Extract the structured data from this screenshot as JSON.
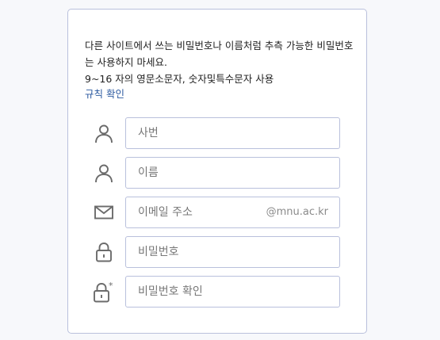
{
  "notice": {
    "line1": "다른 사이트에서 쓰는 비밀번호나 이름처럼 추측 가능한 비밀번호는 사용하지 마세요.",
    "line2": "9~16 자의 영문소문자, 숫자및특수문자 사용",
    "rule_link": "규칙 확인"
  },
  "fields": {
    "student_id": {
      "placeholder": "사번",
      "icon": "user-icon"
    },
    "name": {
      "placeholder": "이름",
      "icon": "user-icon"
    },
    "email": {
      "placeholder": "이메일 주소",
      "suffix": "@mnu.ac.kr",
      "icon": "envelope-icon"
    },
    "password": {
      "placeholder": "비밀번호",
      "icon": "lock-icon"
    },
    "password_confirm": {
      "placeholder": "비밀번호 확인",
      "icon": "lock-asterisk-icon"
    }
  },
  "colors": {
    "border": "#b9c0dc",
    "link": "#2c5aa0",
    "icon": "#6b6b6b"
  }
}
